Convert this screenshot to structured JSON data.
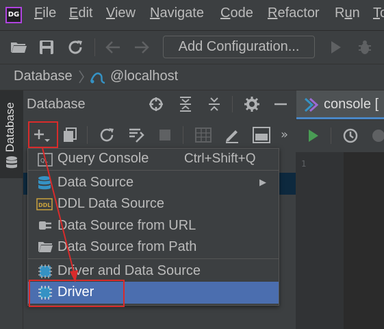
{
  "app": {
    "logo_text": "DG"
  },
  "menu": [
    {
      "pre": "",
      "u": "F",
      "post": "ile"
    },
    {
      "pre": "",
      "u": "E",
      "post": "dit"
    },
    {
      "pre": "",
      "u": "V",
      "post": "iew"
    },
    {
      "pre": "",
      "u": "N",
      "post": "avigate"
    },
    {
      "pre": "",
      "u": "C",
      "post": "ode"
    },
    {
      "pre": "",
      "u": "R",
      "post": "efactor"
    },
    {
      "pre": "R",
      "u": "u",
      "post": "n"
    },
    {
      "pre": "",
      "u": "T",
      "post": "o"
    }
  ],
  "toolbar": {
    "add_configuration": "Add Configuration..."
  },
  "breadcrumb": {
    "root": "Database",
    "host": "@localhost"
  },
  "tool_stripe": {
    "database_tab": "Database"
  },
  "db_panel": {
    "title": "Database"
  },
  "editor": {
    "tab_label": "console [",
    "line_number": "1"
  },
  "popup_menu": {
    "items": [
      {
        "label": "Query Console",
        "shortcut": "Ctrl+Shift+Q",
        "icon": "query-console-icon"
      },
      {
        "label": "Data Source",
        "submenu": "▶",
        "icon": "data-source-icon"
      },
      {
        "label": "DDL Data Source",
        "icon": "ddl-icon"
      },
      {
        "label": "Data Source from URL",
        "icon": "url-icon"
      },
      {
        "label": "Data Source from Path",
        "icon": "folder-icon"
      },
      {
        "label": "Driver and Data Source",
        "icon": "driver-icon"
      },
      {
        "label": "Driver",
        "icon": "driver-icon",
        "selected": true
      }
    ],
    "qc_icon_text": "QL",
    "ddl_icon_text": "DDL"
  },
  "colors": {
    "background": "#3c3f41",
    "selection": "#4b6eaf",
    "annotation": "#d92b2b",
    "run_green": "#499c54"
  }
}
